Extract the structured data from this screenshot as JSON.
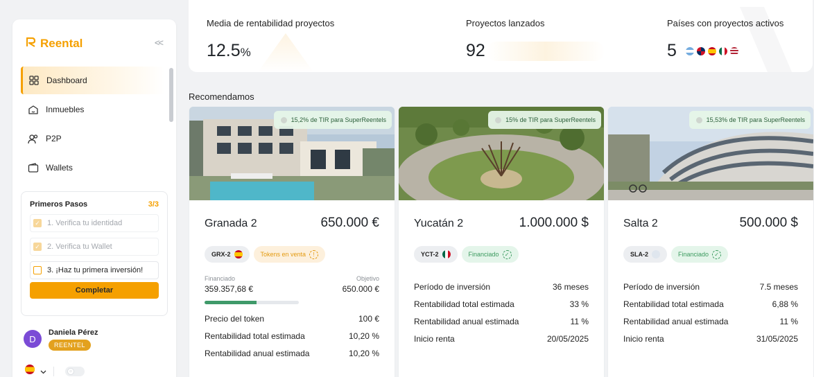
{
  "sidebar": {
    "logo_text": "Reental",
    "collapse_glyph": "<<",
    "nav": [
      {
        "label": "Dashboard",
        "icon": "grid-icon",
        "active": true
      },
      {
        "label": "Inmuebles",
        "icon": "house-icon"
      },
      {
        "label": "P2P",
        "icon": "users-icon"
      },
      {
        "label": "Wallets",
        "icon": "wallet-icon"
      }
    ],
    "steps": {
      "title": "Primeros Pasos",
      "count": "3/3",
      "items": [
        "1. Verifica tu identidad",
        "2. Verifica tu Wallet",
        "3. ¡Haz tu primera inversión!"
      ],
      "button": "Completar"
    },
    "user": {
      "initial": "D",
      "name": "Daniela Pérez",
      "badge": "REENTEL"
    }
  },
  "stats": [
    {
      "label": "Media de rentabilidad proyectos",
      "value": "12.5",
      "unit": "%"
    },
    {
      "label": "Proyectos lanzados",
      "value": "92"
    },
    {
      "label": "Países con proyectos activos",
      "value": "5"
    }
  ],
  "section_title": "Recomendamos",
  "projects": [
    {
      "tir": "15,2% de TIR para SuperReentels",
      "name": "Granada 2",
      "price": "650.000 €",
      "code": "GRX-2",
      "status": "Tokens en venta",
      "funded_label": "Financiado",
      "funded_value": "359.357,68 €",
      "goal_label": "Objetivo",
      "goal_value": "650.000 €",
      "progress": 0.55,
      "rows": [
        {
          "label": "Precio del token",
          "value": "100 €"
        },
        {
          "label": "Rentabilidad total estimada",
          "value": "10,20 %"
        },
        {
          "label": "Rentabilidad anual estimada",
          "value": "10,20 %"
        }
      ]
    },
    {
      "tir": "15% de TIR para SuperReentels",
      "name": "Yucatán 2",
      "price": "1.000.000 $",
      "code": "YCT-2",
      "status": "Financiado",
      "rows": [
        {
          "label": "Período de inversión",
          "value": "36 meses"
        },
        {
          "label": "Rentabilidad total estimada",
          "value": "33 %"
        },
        {
          "label": "Rentabilidad anual estimada",
          "value": "11 %"
        },
        {
          "label": "Inicio renta",
          "value": "20/05/2025"
        }
      ]
    },
    {
      "tir": "15,53% de TIR para SuperReentels",
      "name": "Salta 2",
      "price": "500.000 $",
      "code": "SLA-2",
      "status": "Financiado",
      "rows": [
        {
          "label": "Período de inversión",
          "value": "7.5 meses"
        },
        {
          "label": "Rentabilidad total estimada",
          "value": "6,88 %"
        },
        {
          "label": "Rentabilidad anual estimada",
          "value": "11 %"
        },
        {
          "label": "Inicio renta",
          "value": "31/05/2025"
        }
      ]
    }
  ],
  "colors": {
    "accent": "#f5a000",
    "green": "#3f9a6a",
    "panel": "#ffffff",
    "bg": "#f1f2f4"
  }
}
